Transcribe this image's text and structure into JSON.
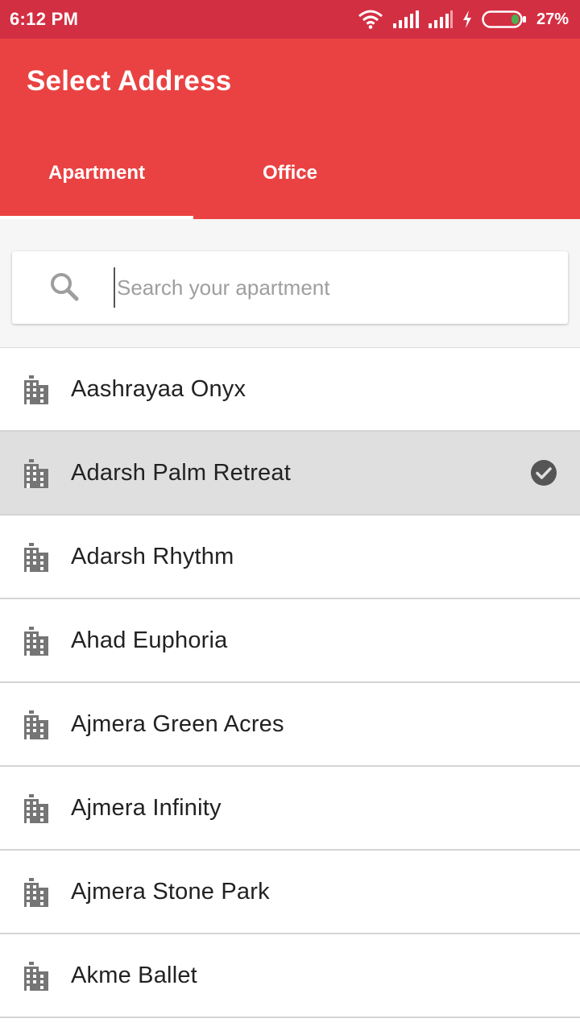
{
  "status_bar": {
    "time": "6:12 PM",
    "battery": "27%",
    "icons": [
      "wifi-icon",
      "signal-icon",
      "signal-icon",
      "charging-icon",
      "battery-icon"
    ],
    "battery_level_percent": 27,
    "battery_fill_color": "#4caf50"
  },
  "app_bar": {
    "title": "Select Address",
    "color": "#ea4242"
  },
  "tabs": [
    {
      "label": "Apartment",
      "active": true
    },
    {
      "label": "Office",
      "active": false
    }
  ],
  "search": {
    "placeholder": "Search your apartment",
    "value": "",
    "icon": "search-icon"
  },
  "list": {
    "item_icon": "building-icon",
    "selected_icon": "check-circle-icon",
    "items": [
      {
        "label": "Aashrayaa Onyx",
        "selected": false
      },
      {
        "label": "Adarsh Palm Retreat",
        "selected": true
      },
      {
        "label": "Adarsh Rhythm",
        "selected": false
      },
      {
        "label": "Ahad Euphoria",
        "selected": false
      },
      {
        "label": "Ajmera Green Acres",
        "selected": false
      },
      {
        "label": "Ajmera Infinity",
        "selected": false
      },
      {
        "label": "Ajmera Stone Park",
        "selected": false
      },
      {
        "label": "Akme Ballet",
        "selected": false
      }
    ]
  }
}
